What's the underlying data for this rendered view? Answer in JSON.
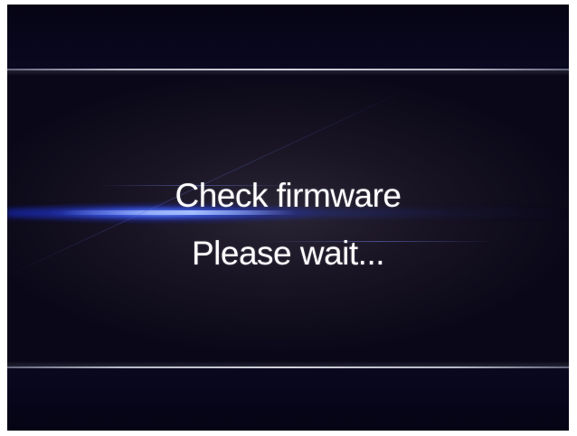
{
  "screen": {
    "title_line": "Check firmware",
    "status_line": "Please wait..."
  },
  "colors": {
    "background": "#07051a",
    "panel": "#1a1525",
    "accent_flare": "#5a78ff",
    "text": "#ffffff"
  }
}
